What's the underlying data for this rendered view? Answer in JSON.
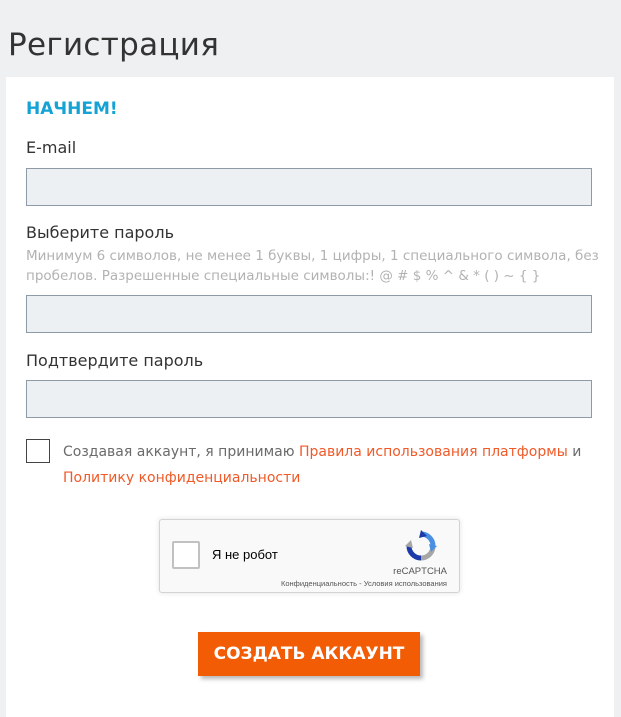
{
  "page": {
    "title": "Регистрация"
  },
  "form": {
    "section_title": "НАЧНЕМ!",
    "email": {
      "label": "E-mail",
      "value": "",
      "placeholder": ""
    },
    "password": {
      "label": "Выберите пароль",
      "hint": "Минимум 6 символов, не менее 1 буквы, 1 цифры, 1 специального символа, без пробелов. Разрешенные специальные символы:! @ # $ % ^ & * ( ) ~ { }",
      "value": "",
      "placeholder": ""
    },
    "confirm": {
      "label": "Подтвердите пароль",
      "value": "",
      "placeholder": ""
    },
    "terms": {
      "checked": false,
      "prefix": "Создавая аккаунт, я принимаю ",
      "link1": "Правила использования платформы",
      "middle": " и ",
      "link2": "Политику конфиденциальности",
      "text_color": "#6b6b6b",
      "link_color": "#f05a28"
    },
    "recaptcha": {
      "label": "Я не робот",
      "brand": "reCAPTCHA",
      "privacy": "Конфиденциальность",
      "separator": " - ",
      "terms": "Условия использования"
    },
    "submit_label": "СОЗДАТЬ АККАУНТ"
  },
  "colors": {
    "accent": "#15a3d6",
    "button": "#f25c05",
    "input_bg": "#edf0f3",
    "page_bg": "#eef0f2"
  }
}
